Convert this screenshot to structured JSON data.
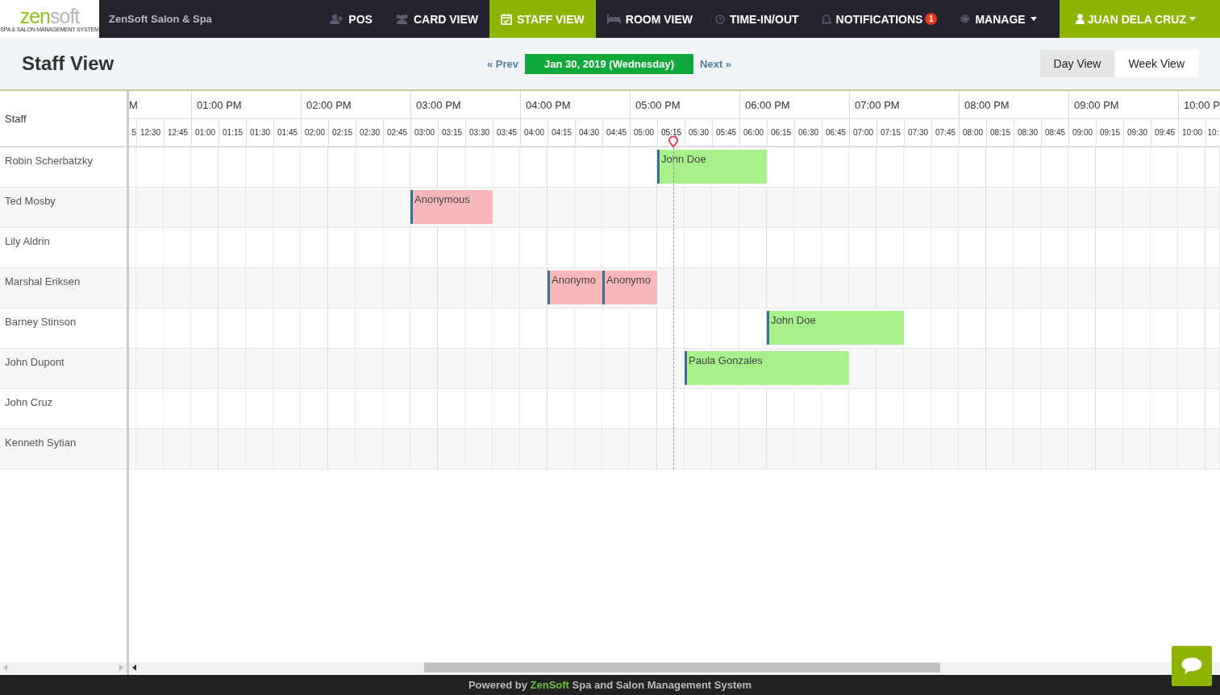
{
  "navbar": {
    "logo": {
      "primary": "zen",
      "secondary": "soft",
      "tagline": "SPA & SALON MANAGEMENT SYSTEM"
    },
    "business": "ZenSoft Salon & Spa",
    "items": [
      {
        "kind": "pos",
        "label": "POS",
        "selected": false
      },
      {
        "kind": "card",
        "label": "CARD VIEW",
        "selected": false
      },
      {
        "kind": "staff",
        "label": "STAFF VIEW",
        "selected": true
      },
      {
        "kind": "room",
        "label": "ROOM VIEW",
        "selected": false
      },
      {
        "kind": "time",
        "label": "TIME-IN/OUT",
        "selected": false
      },
      {
        "kind": "notifications",
        "label": "NOTIFICATIONS",
        "badge": "1",
        "selected": false
      },
      {
        "kind": "manage",
        "label": "MANAGE",
        "dropdown": true,
        "selected": false
      }
    ],
    "user": {
      "label": "JUAN DELA CRUZ"
    }
  },
  "page": {
    "title": "Staff View",
    "prev": "« Prev",
    "date": "Jan 30, 2019 (Wednesday)",
    "next": "Next »",
    "views": [
      {
        "label": "Day View",
        "selected": true
      },
      {
        "label": "Week View",
        "selected": false
      }
    ]
  },
  "schedule": {
    "staff_heading": "Staff",
    "hours": [
      "M",
      "01:00 PM",
      "02:00 PM",
      "03:00 PM",
      "04:00 PM",
      "05:00 PM",
      "06:00 PM",
      "07:00 PM",
      "08:00 PM",
      "09:00 PM",
      "10:00 P"
    ],
    "slots": [
      "5",
      "12:30",
      "12:45",
      "01:00",
      "01:15",
      "01:30",
      "01:45",
      "02:00",
      "02:15",
      "02:30",
      "02:45",
      "03:00",
      "03:15",
      "03:30",
      "03:45",
      "04:00",
      "04:15",
      "04:30",
      "04:45",
      "05:00",
      "05:15",
      "05:30",
      "05:45",
      "06:00",
      "06:15",
      "06:30",
      "06:45",
      "07:00",
      "07:15",
      "07:30",
      "07:45",
      "08:00",
      "08:15",
      "08:30",
      "08:45",
      "09:00",
      "09:15",
      "09:30",
      "09:45",
      "10:00",
      "10:"
    ],
    "now_marker": [
      false,
      false,
      false,
      false,
      false,
      false,
      false,
      false,
      false,
      false,
      false,
      false,
      false,
      false,
      false,
      false,
      false,
      false,
      false,
      false,
      true,
      false,
      false,
      false,
      false,
      false,
      false,
      false,
      false,
      false,
      false,
      false,
      false,
      false,
      false,
      false,
      false,
      false,
      false,
      false,
      false
    ],
    "rows": [
      {
        "staff": "Robin Scherbatzky",
        "appointments": [
          {
            "client": "John Doe",
            "color": "#a8f08a"
          }
        ],
        "booked": [
          false,
          false,
          false,
          false,
          false,
          false,
          false,
          false,
          false,
          false,
          false,
          false,
          false,
          false,
          false,
          false,
          false,
          false,
          false,
          false,
          true,
          true,
          true,
          true,
          false,
          false,
          false,
          false,
          false,
          false,
          false,
          false,
          false,
          false,
          false,
          false,
          false,
          false,
          false,
          false,
          false
        ],
        "starts": [
          false,
          false,
          false,
          false,
          false,
          false,
          false,
          false,
          false,
          false,
          false,
          false,
          false,
          false,
          false,
          false,
          false,
          false,
          false,
          false,
          true,
          false,
          false,
          false,
          false,
          false,
          false,
          false,
          false,
          false,
          false,
          false,
          false,
          false,
          false,
          false,
          false,
          false,
          false,
          false,
          false
        ]
      },
      {
        "staff": "Ted Mosby",
        "appointments": [
          {
            "client": "Anonymous",
            "color": "#f8b8ba"
          }
        ],
        "booked": [
          false,
          false,
          false,
          false,
          false,
          false,
          false,
          false,
          false,
          false,
          false,
          true,
          true,
          true,
          false,
          false,
          false,
          false,
          false,
          false,
          false,
          false,
          false,
          false,
          false,
          false,
          false,
          false,
          false,
          false,
          false,
          false,
          false,
          false,
          false,
          false,
          false,
          false,
          false,
          false,
          false
        ],
        "starts": [
          false,
          false,
          false,
          false,
          false,
          false,
          false,
          false,
          false,
          false,
          false,
          true,
          false,
          false,
          false,
          false,
          false,
          false,
          false,
          false,
          false,
          false,
          false,
          false,
          false,
          false,
          false,
          false,
          false,
          false,
          false,
          false,
          false,
          false,
          false,
          false,
          false,
          false,
          false,
          false,
          false
        ]
      },
      {
        "staff": "Lily Aldrin",
        "appointments": [],
        "booked": [
          false,
          false,
          false,
          false,
          false,
          false,
          false,
          false,
          false,
          false,
          false,
          false,
          false,
          false,
          false,
          false,
          false,
          false,
          false,
          false,
          false,
          false,
          false,
          false,
          false,
          false,
          false,
          false,
          false,
          false,
          false,
          false,
          false,
          false,
          false,
          false,
          false,
          false,
          false,
          false,
          false
        ],
        "starts": [
          false,
          false,
          false,
          false,
          false,
          false,
          false,
          false,
          false,
          false,
          false,
          false,
          false,
          false,
          false,
          false,
          false,
          false,
          false,
          false,
          false,
          false,
          false,
          false,
          false,
          false,
          false,
          false,
          false,
          false,
          false,
          false,
          false,
          false,
          false,
          false,
          false,
          false,
          false,
          false,
          false
        ]
      },
      {
        "staff": "Marshal Eriksen",
        "appointments": [
          {
            "client": "Anonymo",
            "color": "#f8b8ba"
          },
          {
            "client": "Anonymo",
            "color": "#f8b8ba"
          }
        ],
        "booked": [
          false,
          false,
          false,
          false,
          false,
          false,
          false,
          false,
          false,
          false,
          false,
          false,
          false,
          false,
          false,
          false,
          true,
          true,
          true,
          true,
          false,
          false,
          false,
          false,
          false,
          false,
          false,
          false,
          false,
          false,
          false,
          false,
          false,
          false,
          false,
          false,
          false,
          false,
          false,
          false,
          false
        ],
        "starts": [
          false,
          false,
          false,
          false,
          false,
          false,
          false,
          false,
          false,
          false,
          false,
          false,
          false,
          false,
          false,
          false,
          true,
          false,
          true,
          false,
          false,
          false,
          false,
          false,
          false,
          false,
          false,
          false,
          false,
          false,
          false,
          false,
          false,
          false,
          false,
          false,
          false,
          false,
          false,
          false,
          false
        ]
      },
      {
        "staff": "Barney Stinson",
        "appointments": [
          {
            "client": "John Doe",
            "color": "#a8f08a"
          }
        ],
        "booked": [
          false,
          false,
          false,
          false,
          false,
          false,
          false,
          false,
          false,
          false,
          false,
          false,
          false,
          false,
          false,
          false,
          false,
          false,
          false,
          false,
          false,
          false,
          false,
          false,
          true,
          true,
          true,
          true,
          true,
          false,
          false,
          false,
          false,
          false,
          false,
          false,
          false,
          false,
          false,
          false,
          false
        ],
        "starts": [
          false,
          false,
          false,
          false,
          false,
          false,
          false,
          false,
          false,
          false,
          false,
          false,
          false,
          false,
          false,
          false,
          false,
          false,
          false,
          false,
          false,
          false,
          false,
          false,
          true,
          false,
          false,
          false,
          false,
          false,
          false,
          false,
          false,
          false,
          false,
          false,
          false,
          false,
          false,
          false,
          false
        ]
      },
      {
        "staff": "John Dupont",
        "appointments": [
          {
            "client": "Paula Gonzales",
            "color": "#a8f08a"
          }
        ],
        "booked": [
          false,
          false,
          false,
          false,
          false,
          false,
          false,
          false,
          false,
          false,
          false,
          false,
          false,
          false,
          false,
          false,
          false,
          false,
          false,
          false,
          false,
          true,
          true,
          true,
          true,
          true,
          true,
          false,
          false,
          false,
          false,
          false,
          false,
          false,
          false,
          false,
          false,
          false,
          false,
          false,
          false
        ],
        "starts": [
          false,
          false,
          false,
          false,
          false,
          false,
          false,
          false,
          false,
          false,
          false,
          false,
          false,
          false,
          false,
          false,
          false,
          false,
          false,
          false,
          false,
          true,
          false,
          false,
          false,
          false,
          false,
          false,
          false,
          false,
          false,
          false,
          false,
          false,
          false,
          false,
          false,
          false,
          false,
          false,
          false
        ]
      },
      {
        "staff": "John Cruz",
        "appointments": [],
        "booked": [
          false,
          false,
          false,
          false,
          false,
          false,
          false,
          false,
          false,
          false,
          false,
          false,
          false,
          false,
          false,
          false,
          false,
          false,
          false,
          false,
          false,
          false,
          false,
          false,
          false,
          false,
          false,
          false,
          false,
          false,
          false,
          false,
          false,
          false,
          false,
          false,
          false,
          false,
          false,
          false,
          false
        ],
        "starts": [
          false,
          false,
          false,
          false,
          false,
          false,
          false,
          false,
          false,
          false,
          false,
          false,
          false,
          false,
          false,
          false,
          false,
          false,
          false,
          false,
          false,
          false,
          false,
          false,
          false,
          false,
          false,
          false,
          false,
          false,
          false,
          false,
          false,
          false,
          false,
          false,
          false,
          false,
          false,
          false,
          false
        ]
      },
      {
        "staff": "Kenneth Sytian",
        "appointments": [],
        "booked": [
          false,
          false,
          false,
          false,
          false,
          false,
          false,
          false,
          false,
          false,
          false,
          false,
          false,
          false,
          false,
          false,
          false,
          false,
          false,
          false,
          false,
          false,
          false,
          false,
          false,
          false,
          false,
          false,
          false,
          false,
          false,
          false,
          false,
          false,
          false,
          false,
          false,
          false,
          false,
          false,
          false
        ],
        "starts": [
          false,
          false,
          false,
          false,
          false,
          false,
          false,
          false,
          false,
          false,
          false,
          false,
          false,
          false,
          false,
          false,
          false,
          false,
          false,
          false,
          false,
          false,
          false,
          false,
          false,
          false,
          false,
          false,
          false,
          false,
          false,
          false,
          false,
          false,
          false,
          false,
          false,
          false,
          false,
          false,
          false
        ]
      }
    ]
  },
  "footer": {
    "before": "Powered by",
    "brand": "ZenSoft",
    "after": "Spa and Salon Management System"
  }
}
